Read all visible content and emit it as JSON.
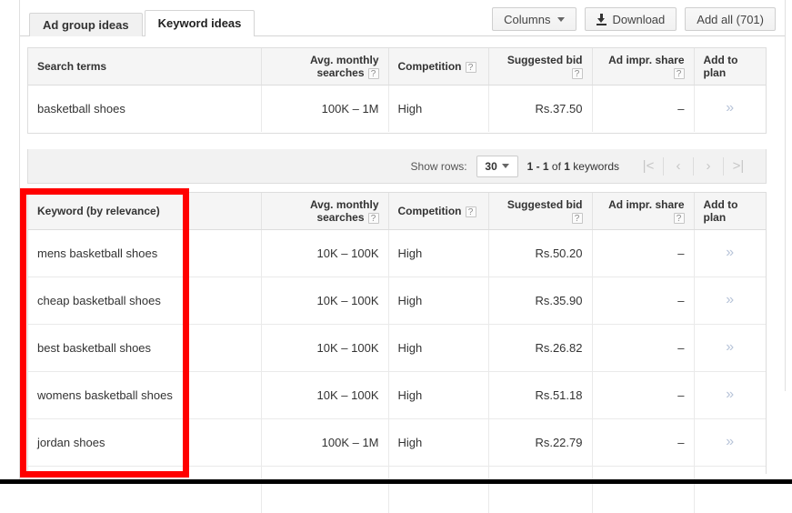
{
  "tabs": [
    {
      "label": "Ad group ideas",
      "active": false
    },
    {
      "label": "Keyword ideas",
      "active": true
    }
  ],
  "toolbar": {
    "columns_label": "Columns",
    "download_label": "Download",
    "add_all_label": "Add all (701)"
  },
  "search_terms_table": {
    "columns": [
      "Search terms",
      "Avg. monthly",
      "searches",
      "Competition",
      "Suggested bid",
      "Ad impr. share",
      "Add to plan"
    ],
    "help_glyph": "?",
    "rows": [
      {
        "term": "basketball shoes",
        "avg_monthly_searches": "100K – 1M",
        "competition": "High",
        "suggested_bid": "Rs.37.50",
        "ad_impr_share": "–",
        "add_to_plan": "»"
      }
    ]
  },
  "pagination": {
    "show_rows_label": "Show rows:",
    "rows_per_page": "30",
    "range_prefix": "1 - 1",
    "range_middle": " of ",
    "range_total": "1",
    "range_suffix": " keywords",
    "nav_first": "|<",
    "nav_prev": "‹",
    "nav_next": "›",
    "nav_last": ">|"
  },
  "keyword_ideas_table": {
    "columns": [
      "Keyword (by relevance)",
      "Avg. monthly",
      "searches",
      "Competition",
      "Suggested bid",
      "Ad impr. share",
      "Add to plan"
    ],
    "help_glyph": "?",
    "rows": [
      {
        "keyword": "mens basketball shoes",
        "avg_monthly_searches": "10K – 100K",
        "competition": "High",
        "suggested_bid": "Rs.50.20",
        "ad_impr_share": "–",
        "add_to_plan": "»"
      },
      {
        "keyword": "cheap basketball shoes",
        "avg_monthly_searches": "10K – 100K",
        "competition": "High",
        "suggested_bid": "Rs.35.90",
        "ad_impr_share": "–",
        "add_to_plan": "»"
      },
      {
        "keyword": "best basketball shoes",
        "avg_monthly_searches": "10K – 100K",
        "competition": "High",
        "suggested_bid": "Rs.26.82",
        "ad_impr_share": "–",
        "add_to_plan": "»"
      },
      {
        "keyword": "womens basketball shoes",
        "avg_monthly_searches": "10K – 100K",
        "competition": "High",
        "suggested_bid": "Rs.51.18",
        "ad_impr_share": "–",
        "add_to_plan": "»"
      },
      {
        "keyword": "jordan shoes",
        "avg_monthly_searches": "100K – 1M",
        "competition": "High",
        "suggested_bid": "Rs.22.79",
        "ad_impr_share": "–",
        "add_to_plan": "»"
      }
    ]
  },
  "annotation": {
    "color": "#ff0000",
    "target": "keyword-column-highlight"
  }
}
